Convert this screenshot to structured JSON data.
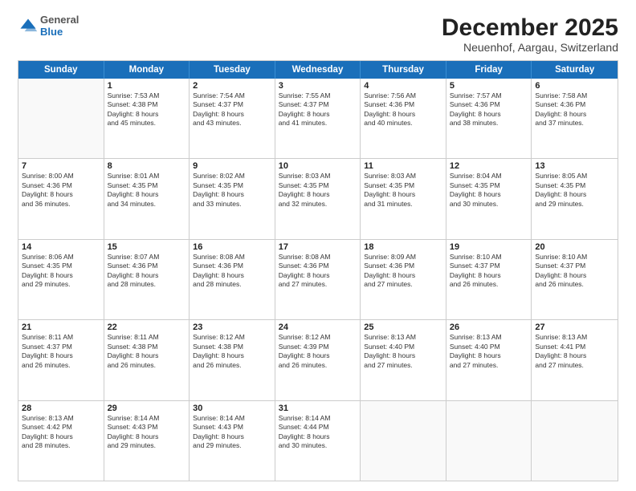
{
  "logo": {
    "general": "General",
    "blue": "Blue"
  },
  "title": "December 2025",
  "location": "Neuenhof, Aargau, Switzerland",
  "days_header": [
    "Sunday",
    "Monday",
    "Tuesday",
    "Wednesday",
    "Thursday",
    "Friday",
    "Saturday"
  ],
  "weeks": [
    [
      {
        "day": "",
        "info": ""
      },
      {
        "day": "1",
        "info": "Sunrise: 7:53 AM\nSunset: 4:38 PM\nDaylight: 8 hours\nand 45 minutes."
      },
      {
        "day": "2",
        "info": "Sunrise: 7:54 AM\nSunset: 4:37 PM\nDaylight: 8 hours\nand 43 minutes."
      },
      {
        "day": "3",
        "info": "Sunrise: 7:55 AM\nSunset: 4:37 PM\nDaylight: 8 hours\nand 41 minutes."
      },
      {
        "day": "4",
        "info": "Sunrise: 7:56 AM\nSunset: 4:36 PM\nDaylight: 8 hours\nand 40 minutes."
      },
      {
        "day": "5",
        "info": "Sunrise: 7:57 AM\nSunset: 4:36 PM\nDaylight: 8 hours\nand 38 minutes."
      },
      {
        "day": "6",
        "info": "Sunrise: 7:58 AM\nSunset: 4:36 PM\nDaylight: 8 hours\nand 37 minutes."
      }
    ],
    [
      {
        "day": "7",
        "info": "Sunrise: 8:00 AM\nSunset: 4:36 PM\nDaylight: 8 hours\nand 36 minutes."
      },
      {
        "day": "8",
        "info": "Sunrise: 8:01 AM\nSunset: 4:35 PM\nDaylight: 8 hours\nand 34 minutes."
      },
      {
        "day": "9",
        "info": "Sunrise: 8:02 AM\nSunset: 4:35 PM\nDaylight: 8 hours\nand 33 minutes."
      },
      {
        "day": "10",
        "info": "Sunrise: 8:03 AM\nSunset: 4:35 PM\nDaylight: 8 hours\nand 32 minutes."
      },
      {
        "day": "11",
        "info": "Sunrise: 8:03 AM\nSunset: 4:35 PM\nDaylight: 8 hours\nand 31 minutes."
      },
      {
        "day": "12",
        "info": "Sunrise: 8:04 AM\nSunset: 4:35 PM\nDaylight: 8 hours\nand 30 minutes."
      },
      {
        "day": "13",
        "info": "Sunrise: 8:05 AM\nSunset: 4:35 PM\nDaylight: 8 hours\nand 29 minutes."
      }
    ],
    [
      {
        "day": "14",
        "info": "Sunrise: 8:06 AM\nSunset: 4:35 PM\nDaylight: 8 hours\nand 29 minutes."
      },
      {
        "day": "15",
        "info": "Sunrise: 8:07 AM\nSunset: 4:36 PM\nDaylight: 8 hours\nand 28 minutes."
      },
      {
        "day": "16",
        "info": "Sunrise: 8:08 AM\nSunset: 4:36 PM\nDaylight: 8 hours\nand 28 minutes."
      },
      {
        "day": "17",
        "info": "Sunrise: 8:08 AM\nSunset: 4:36 PM\nDaylight: 8 hours\nand 27 minutes."
      },
      {
        "day": "18",
        "info": "Sunrise: 8:09 AM\nSunset: 4:36 PM\nDaylight: 8 hours\nand 27 minutes."
      },
      {
        "day": "19",
        "info": "Sunrise: 8:10 AM\nSunset: 4:37 PM\nDaylight: 8 hours\nand 26 minutes."
      },
      {
        "day": "20",
        "info": "Sunrise: 8:10 AM\nSunset: 4:37 PM\nDaylight: 8 hours\nand 26 minutes."
      }
    ],
    [
      {
        "day": "21",
        "info": "Sunrise: 8:11 AM\nSunset: 4:37 PM\nDaylight: 8 hours\nand 26 minutes."
      },
      {
        "day": "22",
        "info": "Sunrise: 8:11 AM\nSunset: 4:38 PM\nDaylight: 8 hours\nand 26 minutes."
      },
      {
        "day": "23",
        "info": "Sunrise: 8:12 AM\nSunset: 4:38 PM\nDaylight: 8 hours\nand 26 minutes."
      },
      {
        "day": "24",
        "info": "Sunrise: 8:12 AM\nSunset: 4:39 PM\nDaylight: 8 hours\nand 26 minutes."
      },
      {
        "day": "25",
        "info": "Sunrise: 8:13 AM\nSunset: 4:40 PM\nDaylight: 8 hours\nand 27 minutes."
      },
      {
        "day": "26",
        "info": "Sunrise: 8:13 AM\nSunset: 4:40 PM\nDaylight: 8 hours\nand 27 minutes."
      },
      {
        "day": "27",
        "info": "Sunrise: 8:13 AM\nSunset: 4:41 PM\nDaylight: 8 hours\nand 27 minutes."
      }
    ],
    [
      {
        "day": "28",
        "info": "Sunrise: 8:13 AM\nSunset: 4:42 PM\nDaylight: 8 hours\nand 28 minutes."
      },
      {
        "day": "29",
        "info": "Sunrise: 8:14 AM\nSunset: 4:43 PM\nDaylight: 8 hours\nand 29 minutes."
      },
      {
        "day": "30",
        "info": "Sunrise: 8:14 AM\nSunset: 4:43 PM\nDaylight: 8 hours\nand 29 minutes."
      },
      {
        "day": "31",
        "info": "Sunrise: 8:14 AM\nSunset: 4:44 PM\nDaylight: 8 hours\nand 30 minutes."
      },
      {
        "day": "",
        "info": ""
      },
      {
        "day": "",
        "info": ""
      },
      {
        "day": "",
        "info": ""
      }
    ]
  ]
}
